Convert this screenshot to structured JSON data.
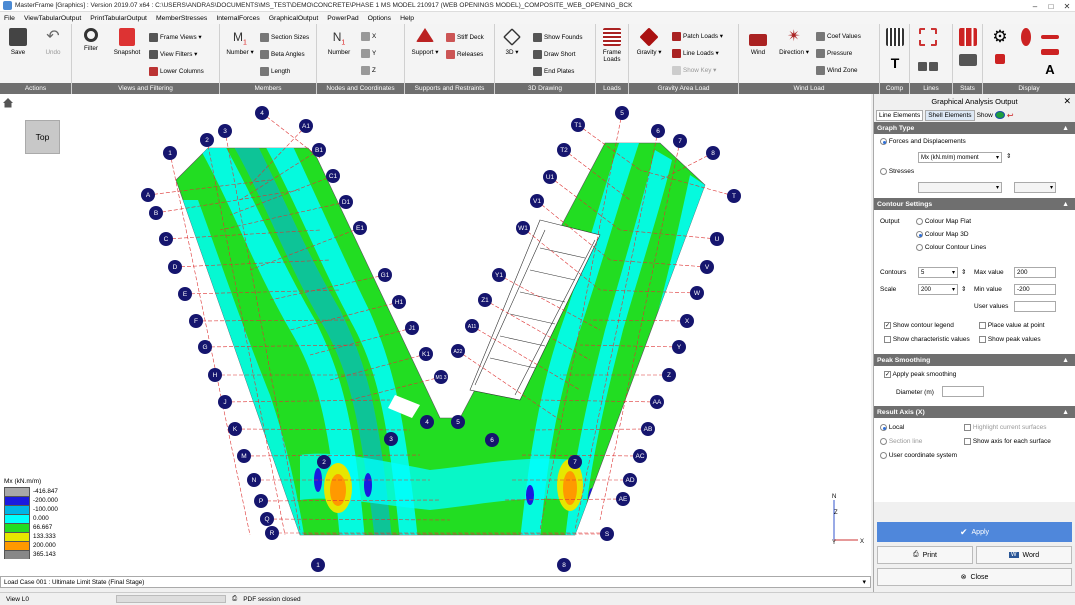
{
  "window": {
    "title": "MasterFrame [Graphics] : Version 2019.07 x64 : C:\\USERS\\ANDRAS\\DOCUMENTS\\MS_TEST\\DEMO\\CONCRETE\\PHASE 1 MS MODEL 210917 (WEB OPENINGS MODEL)_COMPOSITE_WEB_OPENING_BCK"
  },
  "menu": [
    "File",
    "ViewTabularOutput",
    "PrintTabularOutput",
    "MemberStresses",
    "InternalForces",
    "GraphicalOutput",
    "PowerPad",
    "Options",
    "Help"
  ],
  "ribbon": {
    "groups": [
      {
        "label": "Actions"
      },
      {
        "label": "Views and Filtering"
      },
      {
        "label": "Members"
      },
      {
        "label": "Nodes and Coordinates"
      },
      {
        "label": "Supports and Restraints"
      },
      {
        "label": "3D Drawing"
      },
      {
        "label": "Loads"
      },
      {
        "label": "Gravity Area Load"
      },
      {
        "label": "Wind Load"
      },
      {
        "label": "Comp"
      },
      {
        "label": "Lines"
      },
      {
        "label": "Stats"
      },
      {
        "label": "Display"
      }
    ],
    "buttons": {
      "save": "Save",
      "undo": "Undo",
      "filter": "Filter",
      "snapshot": "Snapshot",
      "frame_views": "Frame Views",
      "view_filters": "View Filters",
      "lower_columns": "Lower Columns",
      "number_members": "Number",
      "section_sizes": "Section Sizes",
      "beta_angles": "Beta Angles",
      "length": "Length",
      "number_nodes": "Number",
      "x": "X",
      "y": "Y",
      "z": "Z",
      "support": "Support",
      "stiff_deck": "Stiff Deck",
      "releases": "Releases",
      "three_d": "3D",
      "show_founds": "Show Founds",
      "draw_short": "Draw Short",
      "end_plates": "End Plates",
      "frame_loads": "Frame\nLoads",
      "gravity": "Gravity",
      "patch_loads": "Patch Loads",
      "line_loads": "Line Loads",
      "show_key": "Show Key",
      "wind": "Wind",
      "direction": "Direction",
      "coef_values": "Coef Values",
      "pressure": "Pressure",
      "wind_zone": "Wind Zone"
    }
  },
  "canvas": {
    "view_label": "Top",
    "axis_labels": {
      "n": "N",
      "z": "Z",
      "y": "Y",
      "x": "X"
    },
    "grid_bubbles_top": [
      "1",
      "2",
      "3",
      "4",
      "A1",
      "B1",
      "C1",
      "D1",
      "E1",
      "G1",
      "H1",
      "J1",
      "K1",
      "M1 3",
      "5",
      "6",
      "7",
      "8",
      "T1",
      "T2",
      "U1",
      "V1",
      "W1",
      "Y1",
      "Z1",
      "A11",
      "A22"
    ],
    "grid_bubbles_left": [
      "A",
      "B",
      "C",
      "D",
      "E",
      "F",
      "G",
      "H",
      "J",
      "K",
      "M",
      "N",
      "P",
      "Q",
      "R"
    ],
    "grid_bubbles_right": [
      "T",
      "U",
      "V",
      "W",
      "X",
      "Y",
      "Z",
      "AA",
      "AB",
      "AC",
      "AD",
      "AE",
      "S"
    ],
    "grid_bubbles_inner": [
      "2",
      "3",
      "4",
      "5",
      "6",
      "7"
    ],
    "grid_bubbles_bottom": [
      "1",
      "8"
    ]
  },
  "legend": {
    "title": "Mx (kN.m/m)",
    "rows": [
      {
        "value": "-416.847",
        "color": "#a8a8a8"
      },
      {
        "value": "-200.000",
        "color": "#1a1adf"
      },
      {
        "value": "-100.000",
        "color": "#00b4e6"
      },
      {
        "value": "0.000",
        "color": "#00ffff"
      },
      {
        "value": "66.667",
        "color": "#22dd22"
      },
      {
        "value": "133.333",
        "color": "#e6e600"
      },
      {
        "value": "200.000",
        "color": "#ff9900"
      },
      {
        "value": "365.143",
        "color": "#888888"
      }
    ]
  },
  "loadcase": "Load Case 001 : Ultimate Limit State (Final Stage)",
  "status": {
    "view": "View L0",
    "pdf": "PDF session closed"
  },
  "panel": {
    "title": "Graphical Analysis Output",
    "tabs": [
      "Line Elements",
      "Shell Elements",
      "Show"
    ],
    "graph_type": {
      "header": "Graph Type",
      "forces": "Forces and Displacements",
      "forces_select": "Mx (kN.m/m) moment",
      "stresses": "Stresses"
    },
    "contour": {
      "header": "Contour Settings",
      "output_label": "Output",
      "flat": "Colour Map Flat",
      "three_d": "Colour Map 3D",
      "lines": "Colour Contour Lines",
      "contours_label": "Contours",
      "contours_value": "5",
      "scale_label": "Scale",
      "scale_value": "200",
      "max_label": "Max value",
      "max_value": "200",
      "min_label": "Min value",
      "min_value": "-200",
      "user_label": "User values",
      "show_legend": "Show contour legend",
      "place_value": "Place value at point",
      "show_char": "Show characteristic values",
      "show_peak": "Show peak values"
    },
    "peak": {
      "header": "Peak Smoothing",
      "apply": "Apply peak smoothing",
      "diameter": "Diameter (m)"
    },
    "result_axis": {
      "header": "Result Axis (X)",
      "local": "Local",
      "section_line": "Section line",
      "user_coord": "User coordinate system",
      "highlight": "Highlight current surfaces",
      "show_axis": "Show axis for each surface"
    },
    "buttons": {
      "apply": "Apply",
      "print": "Print",
      "word": "Word",
      "close": "Close"
    }
  }
}
